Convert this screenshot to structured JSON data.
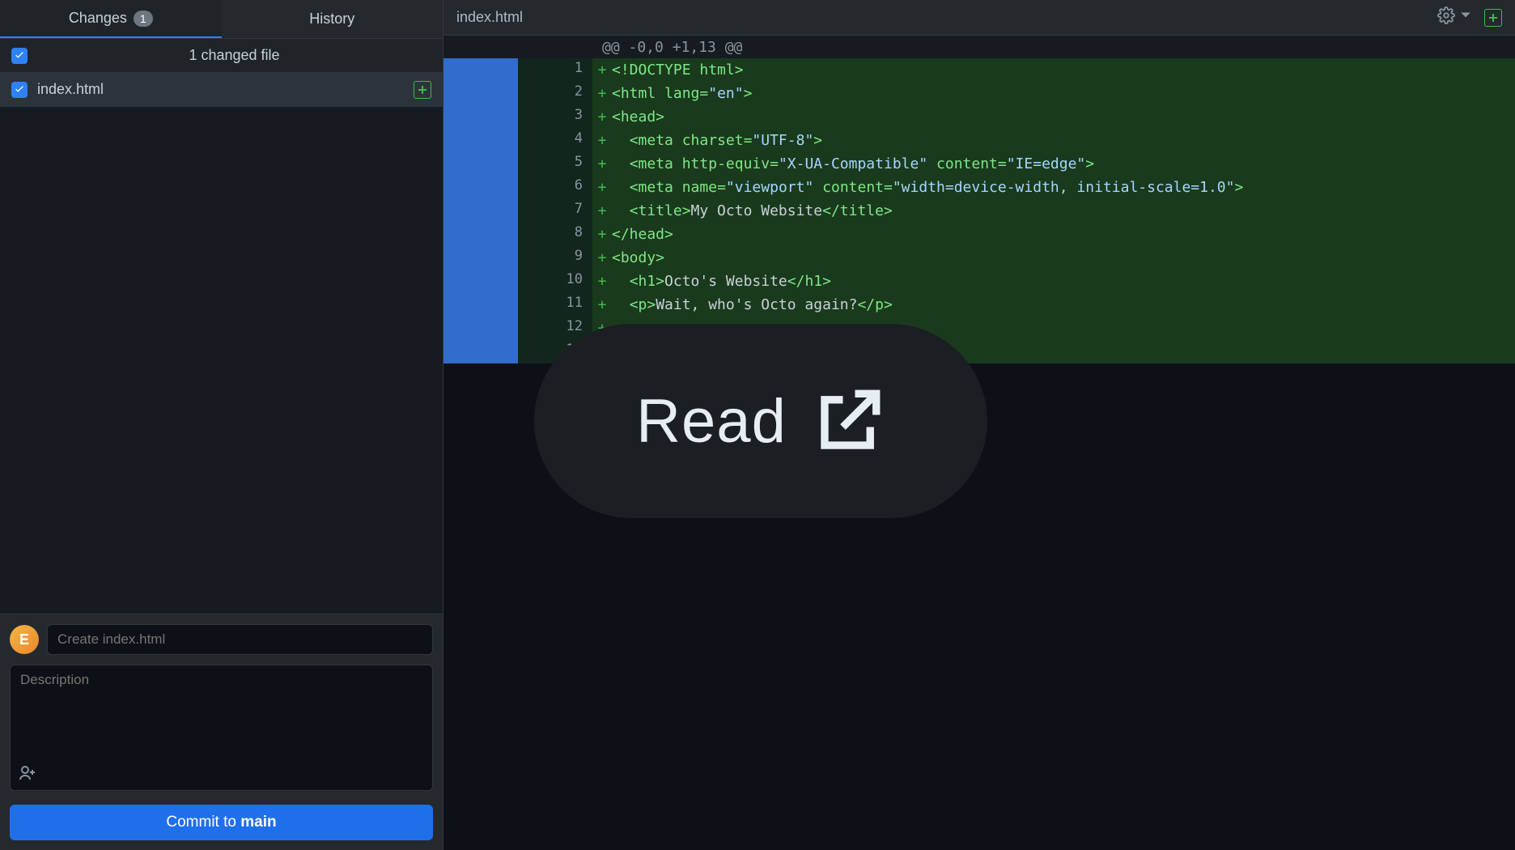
{
  "sidebar": {
    "tabs": {
      "changes": "Changes",
      "changes_count": "1",
      "history": "History"
    },
    "summary": "1 changed file",
    "file": {
      "name": "index.html"
    },
    "commit": {
      "avatar_initial": "E",
      "summary_placeholder": "Create index.html",
      "description_placeholder": "Description",
      "button_prefix": "Commit to ",
      "button_branch": "main"
    }
  },
  "header": {
    "file_name": "index.html"
  },
  "diff": {
    "hunk": "@@ -0,0 +1,13 @@",
    "lines": [
      {
        "n": "1",
        "tokens": [
          {
            "c": "tok-tag",
            "t": "<!DOCTYPE html>"
          }
        ]
      },
      {
        "n": "2",
        "tokens": [
          {
            "c": "tok-tag",
            "t": "<html "
          },
          {
            "c": "tok-attr",
            "t": "lang"
          },
          {
            "c": "tok-tag",
            "t": "="
          },
          {
            "c": "tok-str",
            "t": "\"en\""
          },
          {
            "c": "tok-tag",
            "t": ">"
          }
        ]
      },
      {
        "n": "3",
        "tokens": [
          {
            "c": "tok-tag",
            "t": "<head>"
          }
        ]
      },
      {
        "n": "4",
        "tokens": [
          {
            "c": "tok-text",
            "t": "  "
          },
          {
            "c": "tok-tag",
            "t": "<meta "
          },
          {
            "c": "tok-attr",
            "t": "charset"
          },
          {
            "c": "tok-tag",
            "t": "="
          },
          {
            "c": "tok-str",
            "t": "\"UTF-8\""
          },
          {
            "c": "tok-tag",
            "t": ">"
          }
        ]
      },
      {
        "n": "5",
        "tokens": [
          {
            "c": "tok-text",
            "t": "  "
          },
          {
            "c": "tok-tag",
            "t": "<meta "
          },
          {
            "c": "tok-attr",
            "t": "http-equiv"
          },
          {
            "c": "tok-tag",
            "t": "="
          },
          {
            "c": "tok-str",
            "t": "\"X-UA-Compatible\""
          },
          {
            "c": "tok-tag",
            "t": " "
          },
          {
            "c": "tok-attr",
            "t": "content"
          },
          {
            "c": "tok-tag",
            "t": "="
          },
          {
            "c": "tok-str",
            "t": "\"IE=edge\""
          },
          {
            "c": "tok-tag",
            "t": ">"
          }
        ]
      },
      {
        "n": "6",
        "tokens": [
          {
            "c": "tok-text",
            "t": "  "
          },
          {
            "c": "tok-tag",
            "t": "<meta "
          },
          {
            "c": "tok-attr",
            "t": "name"
          },
          {
            "c": "tok-tag",
            "t": "="
          },
          {
            "c": "tok-str",
            "t": "\"viewport\""
          },
          {
            "c": "tok-tag",
            "t": " "
          },
          {
            "c": "tok-attr",
            "t": "content"
          },
          {
            "c": "tok-tag",
            "t": "="
          },
          {
            "c": "tok-str",
            "t": "\"width=device-width, initial-scale=1.0\""
          },
          {
            "c": "tok-tag",
            "t": ">"
          }
        ]
      },
      {
        "n": "7",
        "tokens": [
          {
            "c": "tok-text",
            "t": "  "
          },
          {
            "c": "tok-tag",
            "t": "<title>"
          },
          {
            "c": "tok-text",
            "t": "My Octo Website"
          },
          {
            "c": "tok-tag",
            "t": "</title>"
          }
        ]
      },
      {
        "n": "8",
        "tokens": [
          {
            "c": "tok-tag",
            "t": "</head>"
          }
        ]
      },
      {
        "n": "9",
        "tokens": [
          {
            "c": "tok-tag",
            "t": "<body>"
          }
        ]
      },
      {
        "n": "10",
        "tokens": [
          {
            "c": "tok-text",
            "t": "  "
          },
          {
            "c": "tok-tag",
            "t": "<h1>"
          },
          {
            "c": "tok-text",
            "t": "Octo's Website"
          },
          {
            "c": "tok-tag",
            "t": "</h1>"
          }
        ]
      },
      {
        "n": "11",
        "tokens": [
          {
            "c": "tok-text",
            "t": "  "
          },
          {
            "c": "tok-tag",
            "t": "<p>"
          },
          {
            "c": "tok-text",
            "t": "Wait, who's Octo again?"
          },
          {
            "c": "tok-tag",
            "t": "</p>"
          }
        ]
      },
      {
        "n": "12",
        "tokens": []
      },
      {
        "n": "13",
        "tokens": []
      }
    ]
  },
  "overlay": {
    "label": "Read"
  }
}
